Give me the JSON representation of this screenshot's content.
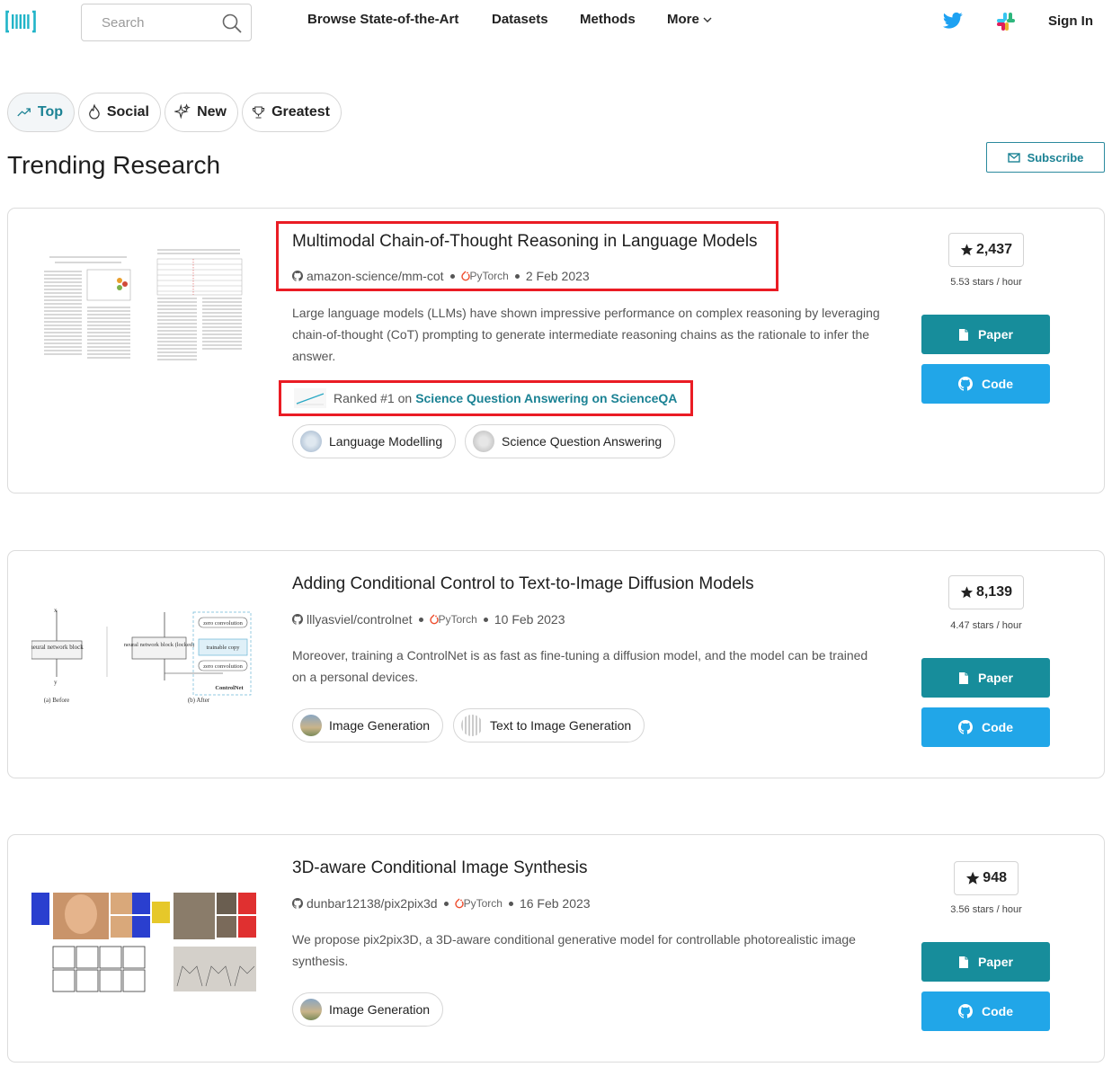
{
  "nav": {
    "search_placeholder": "Search",
    "links": [
      "Browse State-of-the-Art",
      "Datasets",
      "Methods",
      "More"
    ],
    "sign_in": "Sign In"
  },
  "filters": [
    {
      "label": "Top",
      "icon": "trending-up-icon",
      "active": true
    },
    {
      "label": "Social",
      "icon": "fire-icon",
      "active": false
    },
    {
      "label": "New",
      "icon": "sparkles-icon",
      "active": false
    },
    {
      "label": "Greatest",
      "icon": "trophy-icon",
      "active": false
    }
  ],
  "page_title": "Trending Research",
  "subscribe_label": "Subscribe",
  "paper_label": "Paper",
  "code_label": "Code",
  "framework": "PyTorch",
  "ranked_prefix": "Ranked #1 on",
  "papers": [
    {
      "title": "Multimodal Chain-of-Thought Reasoning in Language Models",
      "repo": "amazon-science/mm-cot",
      "date": "2 Feb 2023",
      "abstract": "Large language models (LLMs) have shown impressive performance on complex reasoning by leveraging chain-of-thought (CoT) prompting to generate intermediate reasoning chains as the rationale to infer the answer.",
      "ranked_task": "Science Question Answering on ScienceQA",
      "tags": [
        "Language Modelling",
        "Science Question Answering"
      ],
      "stars": "2,437",
      "rate": "5.53 stars / hour"
    },
    {
      "title": "Adding Conditional Control to Text-to-Image Diffusion Models",
      "repo": "lllyasviel/controlnet",
      "date": "10 Feb 2023",
      "abstract": "Moreover, training a ControlNet is as fast as fine-tuning a diffusion model, and the model can be trained on a personal devices.",
      "tags": [
        "Image Generation",
        "Text to Image Generation"
      ],
      "stars": "8,139",
      "rate": "4.47 stars / hour",
      "diagram": {
        "nn_block": "neural network block",
        "nn_locked": "neural network block (locked)",
        "zero_conv": "zero convolution",
        "trainable": "trainable copy",
        "controlnet": "ControlNet",
        "before": "(a) Before",
        "after": "(b) After"
      }
    },
    {
      "title": "3D-aware Conditional Image Synthesis",
      "repo": "dunbar12138/pix2pix3d",
      "date": "16 Feb 2023",
      "abstract": "We propose pix2pix3D, a 3D-aware conditional generative model for controllable photorealistic image synthesis.",
      "tags": [
        "Image Generation"
      ],
      "stars": "948",
      "rate": "3.56 stars / hour"
    }
  ],
  "colors": {
    "accent": "#1b8294",
    "paper_button": "#178d9b",
    "code_button": "#21a6e8",
    "highlight_box": "#ea1c24"
  }
}
